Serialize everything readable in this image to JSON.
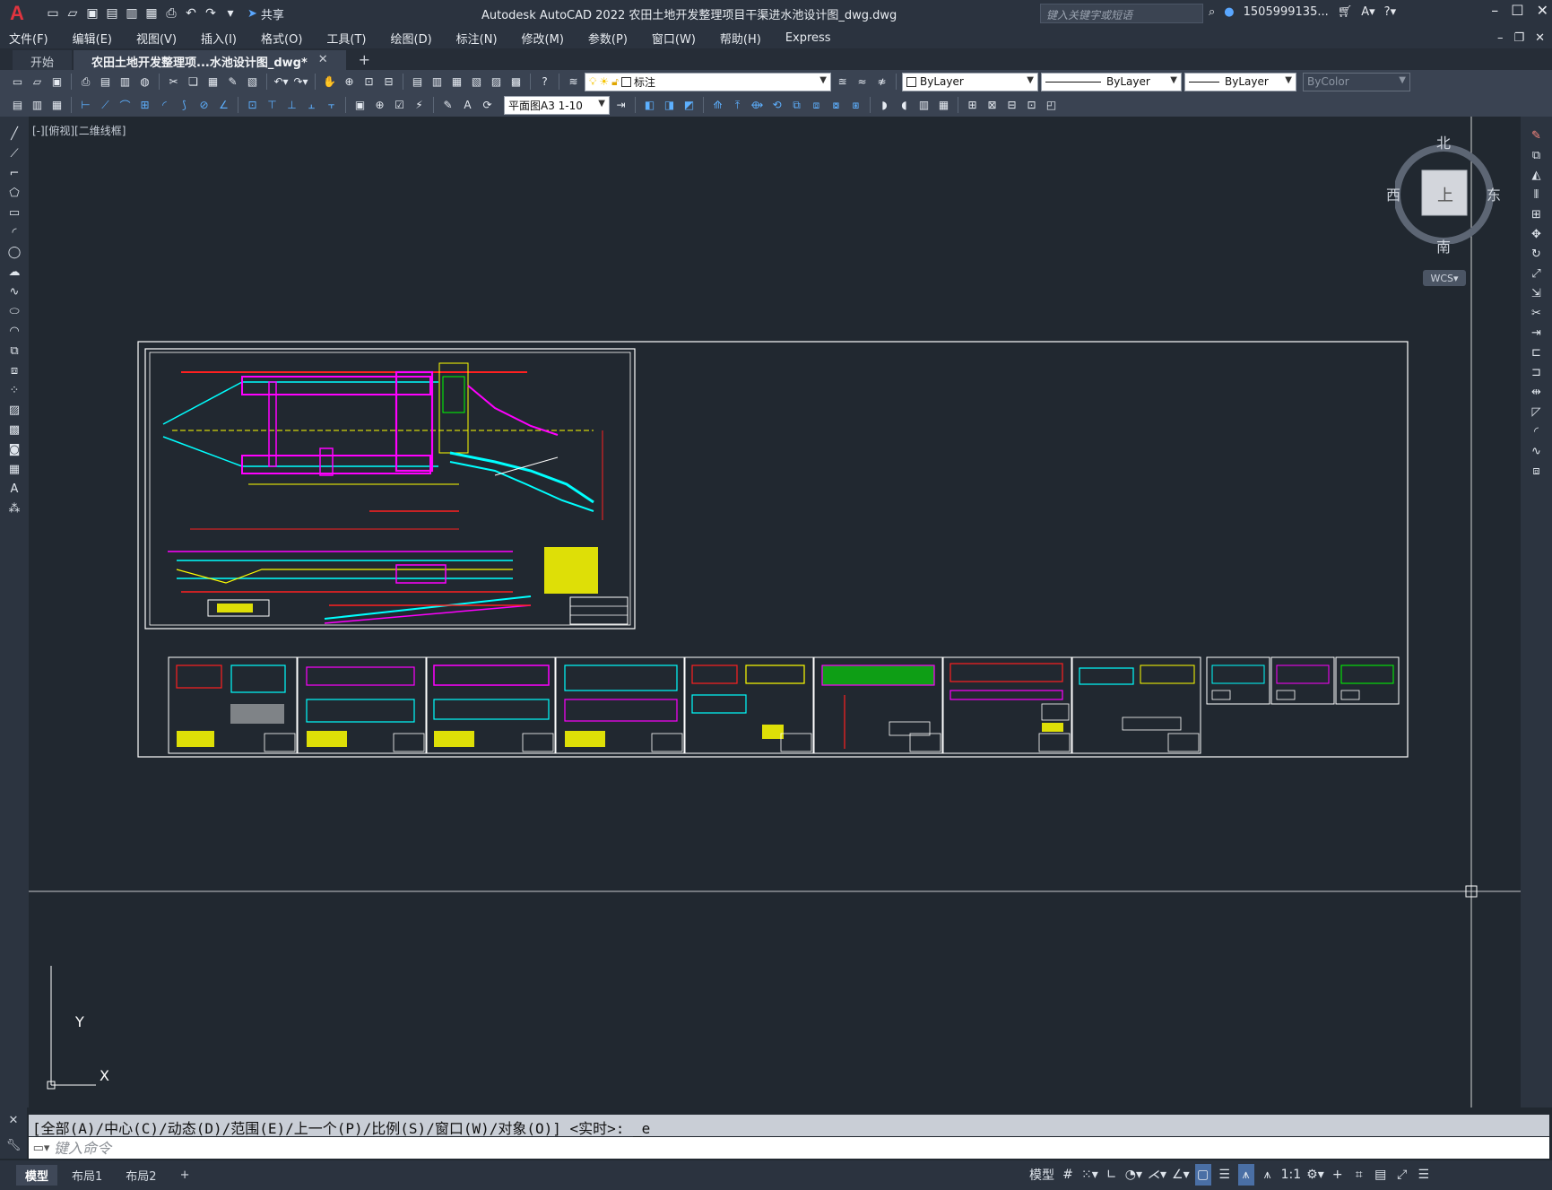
{
  "app": {
    "title": "Autodesk AutoCAD 2022    农田土地开发整理项目干渠进水池设计图_dwg.dwg",
    "search_placeholder": "键入关键字或短语",
    "user": "1505999135...",
    "share_label": "共享"
  },
  "menu": [
    "文件(F)",
    "编辑(E)",
    "视图(V)",
    "插入(I)",
    "格式(O)",
    "工具(T)",
    "绘图(D)",
    "标注(N)",
    "修改(M)",
    "参数(P)",
    "窗口(W)",
    "帮助(H)",
    "Express"
  ],
  "tabs": [
    {
      "label": "开始"
    },
    {
      "label": "农田土地开发整理项...水池设计图_dwg*"
    }
  ],
  "toolbar": {
    "layer_name": "标注",
    "color": "ByLayer",
    "linetype": "ByLayer",
    "lineweight": "ByLayer",
    "plotstyle": "ByColor",
    "view_name": "平面图A3 1-10"
  },
  "viewport": {
    "label": "[-][俯视][二维线框]"
  },
  "viewcube": {
    "north": "北",
    "south": "南",
    "east": "东",
    "west": "西",
    "top": "上",
    "wcs": "WCS"
  },
  "ucs": {
    "x_label": "X",
    "y_label": "Y"
  },
  "command": {
    "history": "[全部(A)/中心(C)/动态(D)/范围(E)/上一个(P)/比例(S)/窗口(W)/对象(O)] <实时>: _e",
    "placeholder": "键入命令"
  },
  "status": {
    "layouts": [
      "模型",
      "布局1",
      "布局2"
    ],
    "model_label": "模型",
    "scale": "1:1"
  },
  "colors": {
    "canvas": "#212830",
    "ui_dark": "#2b333f",
    "accent_red": "#e1343f",
    "yellow": "#ffff00",
    "cyan": "#00ffff",
    "magenta": "#ff00ff",
    "green": "#00ff00"
  }
}
